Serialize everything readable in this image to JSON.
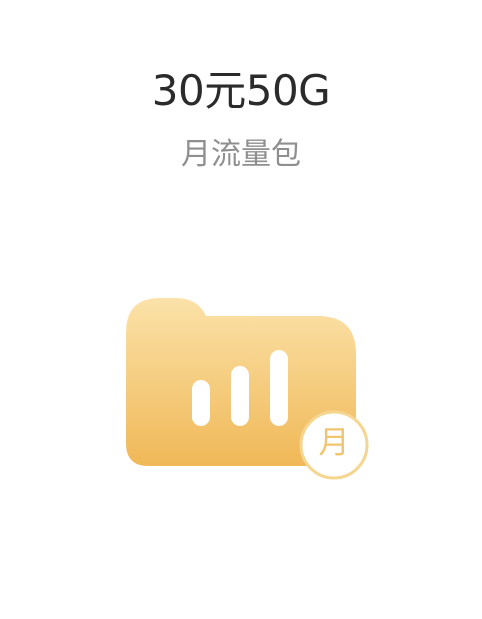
{
  "offer": {
    "title": "30元50G",
    "subtitle": "月流量包",
    "badge_label": "月"
  },
  "icon": {
    "name": "signal-folder-icon",
    "bar_levels": [
      0.5,
      0.75,
      1.0
    ]
  },
  "colors": {
    "title": "#2b2b2b",
    "subtitle": "#8f8f8f",
    "gradient_top": "#fbe2a9",
    "gradient_bottom": "#f0b857",
    "badge_ring": "#f6d58f",
    "badge_text": "#f0c56e"
  }
}
